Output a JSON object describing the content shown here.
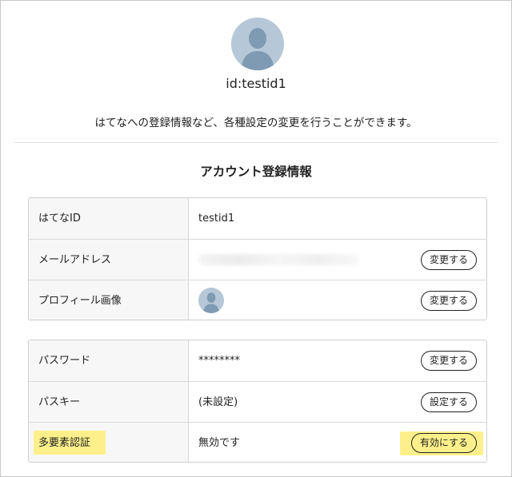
{
  "profile": {
    "user_id": "id:testid1",
    "intro_text": "はてなへの登録情報など、各種設定の変更を行うことができます。"
  },
  "section": {
    "title": "アカウント登録情報"
  },
  "account_rows": [
    {
      "label": "はてなID",
      "value": "testid1",
      "button": ""
    },
    {
      "label": "メールアドレス",
      "value": "",
      "button": "変更する"
    },
    {
      "label": "プロフィール画像",
      "value": "",
      "button": "変更する"
    }
  ],
  "security_rows": [
    {
      "label": "パスワード",
      "value": "********",
      "button": "変更する"
    },
    {
      "label": "パスキー",
      "value": "(未設定)",
      "button": "設定する"
    },
    {
      "label": "多要素認証",
      "value": "無効です",
      "button": "有効にする"
    }
  ],
  "colors": {
    "highlight": "#fdf08a",
    "avatar_bg": "#b6c8d8",
    "avatar_figure": "#7f9ab3"
  }
}
